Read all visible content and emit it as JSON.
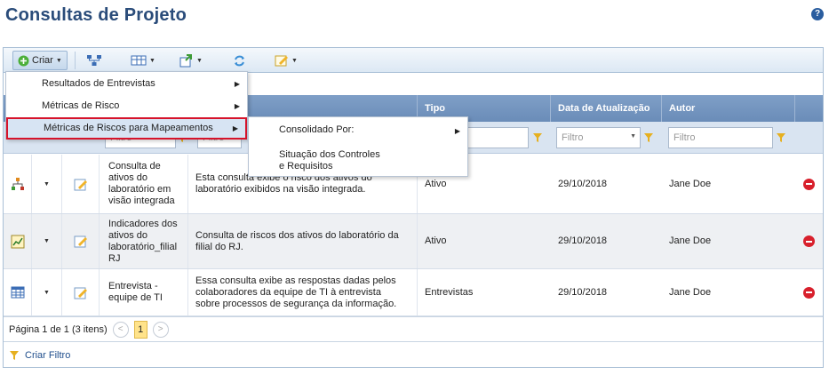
{
  "page": {
    "title": "Consultas de Projeto",
    "help": "?"
  },
  "toolbar": {
    "criar": "Criar"
  },
  "columns": {
    "tipo": "Tipo",
    "data": "Data de Atualização",
    "autor": "Autor"
  },
  "filters": {
    "placeholder": "Filtro"
  },
  "menu": {
    "items": [
      {
        "label": "Resultados de Entrevistas"
      },
      {
        "label": "Métricas de Risco"
      },
      {
        "label": "Métricas de Riscos para Mapeamentos"
      }
    ]
  },
  "submenu": {
    "items": [
      {
        "label": "Consolidado Por:"
      },
      {
        "label": "Situação dos Controles e Requisitos"
      }
    ]
  },
  "rows": [
    {
      "name": "Consulta de ativos do laboratório em visão integrada",
      "description": "Esta consulta exibe o risco dos ativos do laboratório exibidos na visão integrada.",
      "tipo": "Ativo",
      "data": "29/10/2018",
      "autor": "Jane Doe"
    },
    {
      "name": "Indicadores dos ativos do laboratório_filial RJ",
      "description": "Consulta de riscos dos ativos do laboratório da filial do RJ.",
      "tipo": "Ativo",
      "data": "29/10/2018",
      "autor": "Jane Doe"
    },
    {
      "name": "Entrevista - equipe de TI",
      "description": "Essa consulta exibe as respostas dadas pelos colaboradores da equipe de TI à entrevista sobre processos de segurança da informação.",
      "tipo": "Entrevistas",
      "data": "29/10/2018",
      "autor": "Jane Doe"
    }
  ],
  "pager": {
    "info": "Página 1 de 1 (3 itens)",
    "current": "1",
    "prev": "<",
    "next": ">"
  },
  "footer": {
    "criar_filtro": "Criar Filtro"
  }
}
